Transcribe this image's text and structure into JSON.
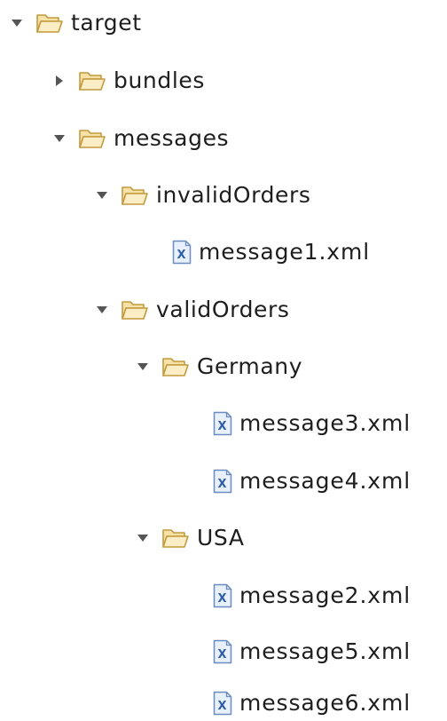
{
  "tree": {
    "root": {
      "label": "target",
      "icon": "folder-open-icon",
      "expanded": true
    },
    "bundles": {
      "label": "bundles",
      "icon": "folder-open-icon",
      "expanded": false
    },
    "messages": {
      "label": "messages",
      "icon": "folder-open-icon",
      "expanded": true
    },
    "invalidOrders": {
      "label": "invalidOrders",
      "icon": "folder-open-icon",
      "expanded": true,
      "files": [
        "message1.xml"
      ]
    },
    "validOrders": {
      "label": "validOrders",
      "icon": "folder-open-icon",
      "expanded": true
    },
    "germany": {
      "label": "Germany",
      "icon": "folder-open-icon",
      "expanded": true,
      "files": [
        "message3.xml",
        "message4.xml"
      ]
    },
    "usa": {
      "label": "USA",
      "icon": "folder-open-icon",
      "expanded": true,
      "files": [
        "message2.xml",
        "message5.xml",
        "message6.xml"
      ]
    },
    "file_icon": "xml-file-icon"
  },
  "colors": {
    "folder_fill": "#f6e2a8",
    "folder_stroke": "#c49a3c",
    "xml_file_fill": "#e8f0fb",
    "xml_file_stroke": "#6b8cc2",
    "xml_badge": "#2f5fa8",
    "twisty": "#555555",
    "text": "#1e1e1e"
  }
}
